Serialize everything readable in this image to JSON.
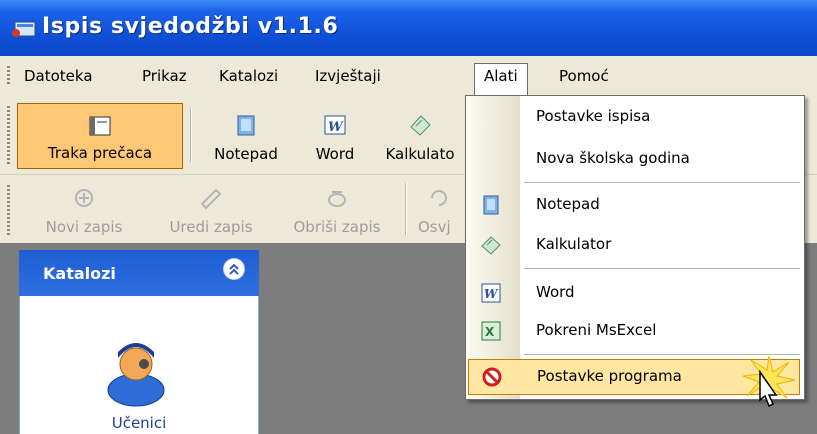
{
  "window": {
    "title": "Ispis svjedodžbi v1.1.6"
  },
  "menubar": {
    "items": [
      {
        "label": "Datoteka"
      },
      {
        "label": "Prikaz"
      },
      {
        "label": "Katalozi"
      },
      {
        "label": "Izvještaji"
      },
      {
        "label": "Alati"
      },
      {
        "label": "Pomoć"
      }
    ],
    "active": "Alati"
  },
  "toolbar1": {
    "buttons": [
      {
        "label": "Traka prečaca",
        "icon": "shortcut-bar-icon"
      },
      {
        "label": "Notepad",
        "icon": "notepad-icon"
      },
      {
        "label": "Word",
        "icon": "word-icon"
      },
      {
        "label": "Kalkulato",
        "icon": "calculator-icon"
      }
    ]
  },
  "toolbar2": {
    "buttons": [
      {
        "label": "Novi zapis",
        "icon": "new-record-icon"
      },
      {
        "label": "Uredi zapis",
        "icon": "edit-record-icon"
      },
      {
        "label": "Obriši zapis",
        "icon": "delete-record-icon"
      },
      {
        "label": "Osvj",
        "icon": "refresh-icon"
      }
    ]
  },
  "panel": {
    "title": "Katalozi",
    "items": [
      {
        "label": "Učenici",
        "icon": "student-icon"
      }
    ]
  },
  "dropdown": {
    "items": [
      {
        "label": "Postavke ispisa",
        "icon": ""
      },
      {
        "label": "Nova školska godina",
        "icon": ""
      },
      {
        "label": "Notepad",
        "icon": "notepad-icon"
      },
      {
        "label": "Kalkulator",
        "icon": "calculator-icon"
      },
      {
        "label": "Word",
        "icon": "word-icon"
      },
      {
        "label": "Pokreni MsExcel",
        "icon": "excel-icon"
      },
      {
        "label": "Postavke programa",
        "icon": "no-entry-icon"
      }
    ],
    "highlighted": "Postavke programa"
  },
  "colors": {
    "titlebar": "#0f51d7",
    "menubar": "#ece9d8",
    "highlight": "#ffe7a2",
    "active_button": "#ffc877",
    "panel_header": "#1e5ed3"
  }
}
